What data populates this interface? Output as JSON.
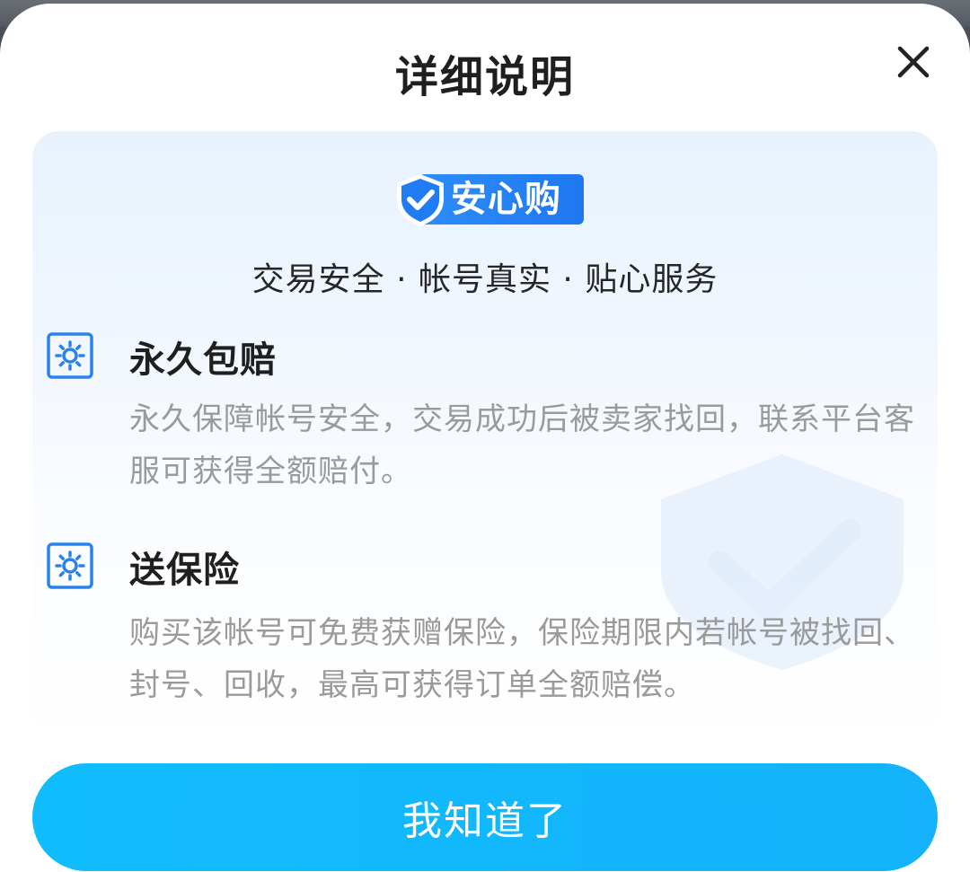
{
  "dialog": {
    "title": "详细说明",
    "close_icon": "close-icon"
  },
  "badge": {
    "label": "安心购",
    "icon": "shield-check-icon"
  },
  "tagline": "交易安全 · 帐号真实 · 贴心服务",
  "features": [
    {
      "icon": "settings-icon",
      "title": "永久包赔",
      "description": "永久保障帐号安全，交易成功后被卖家找回，联系平台客服可获得全额赔付。"
    },
    {
      "icon": "settings-icon",
      "title": "送保险",
      "description": "购买该帐号可免费获赠保险，保险期限内若帐号被找回、封号、回收，最高可获得订单全额赔偿。"
    }
  ],
  "confirm_button": {
    "label": "我知道了"
  },
  "colors": {
    "accent": "#14b3fb",
    "badge_blue": "#1f78f0",
    "icon_blue": "#2a83ea",
    "title_text": "#1f1f1f",
    "desc_text": "#9a9a9a"
  }
}
